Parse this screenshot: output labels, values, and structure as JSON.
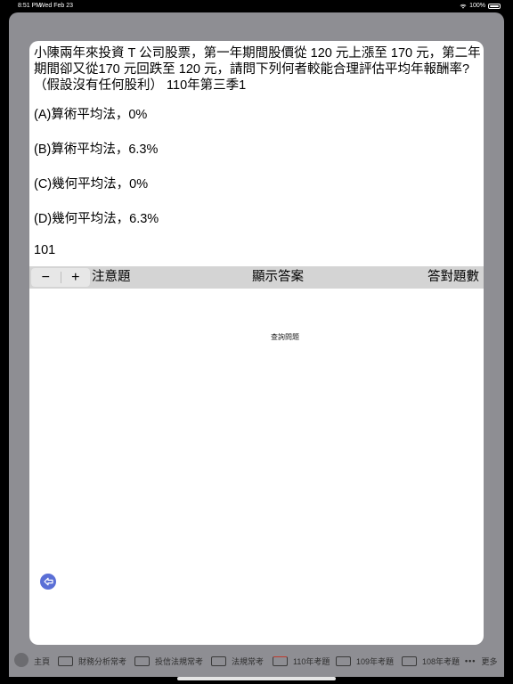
{
  "status": {
    "time": "8:51 PM",
    "date": "Wed Feb 23",
    "battery": "100%"
  },
  "question": {
    "text": "小陳兩年來投資 T 公司股票，第一年期間股價從 120 元上漲至 170 元，第二年期間卻又從170 元回跌至 120 元，請問下列何者較能合理評估平均年報酬率?（假設沒有任何股利） 110年第三季1",
    "options": [
      "(A)算術平均法，0%",
      "(B)算術平均法，6.3%",
      "(C)幾何平均法，0%",
      "(D)幾何平均法，6.3%"
    ],
    "number": "101"
  },
  "controls": {
    "minus": "−",
    "plus": "+",
    "attention": "注意題",
    "show_answer": "顯示答案",
    "correct_count": "答對題數"
  },
  "query_label": "查詢問題",
  "tabs": {
    "home": "主頁",
    "financial_analysis": "財務分析常考",
    "investment_regulation": "投信法規常考",
    "regulation": "法規常考",
    "y110": "110年考題",
    "y109": "109年考題",
    "y108": "108年考題",
    "more": "更多"
  },
  "icons": {
    "back": "back-arrow-icon",
    "wifi": "wifi-icon",
    "battery": "battery-icon"
  },
  "colors": {
    "accent": "#3f63b5",
    "fab": "#5a6fd6"
  }
}
